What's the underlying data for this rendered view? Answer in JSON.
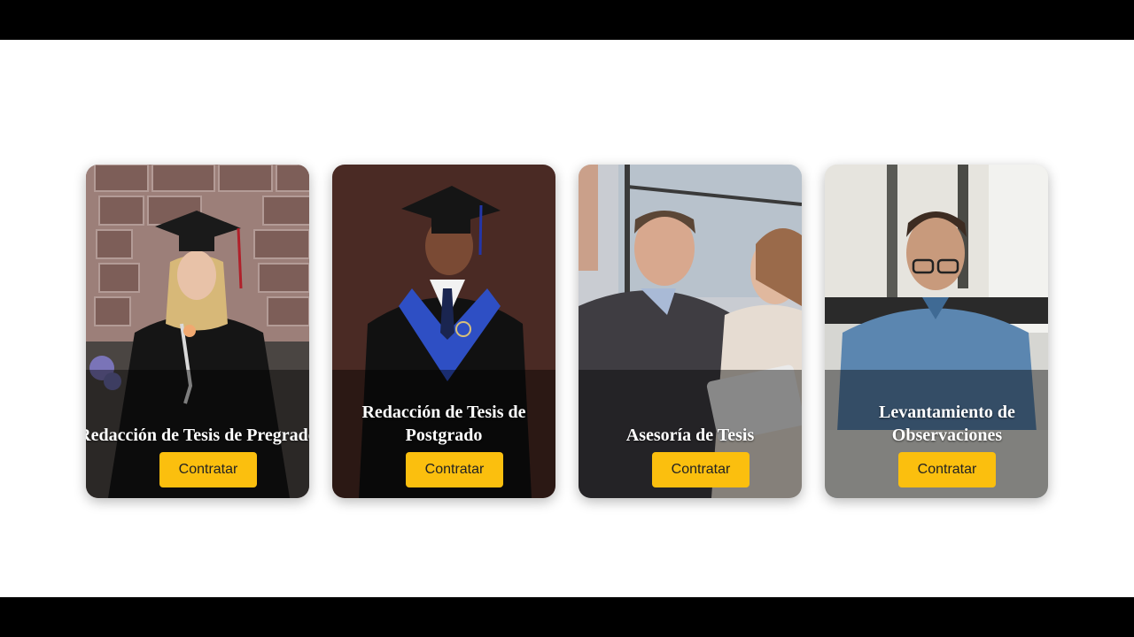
{
  "services": [
    {
      "title": "Redacción de Tesis de Pregrado",
      "button": "Contratar"
    },
    {
      "title": "Redacción de Tesis de Postgrado",
      "button": "Contratar"
    },
    {
      "title": "Asesoría de Tesis",
      "button": "Contratar"
    },
    {
      "title": "Levantamiento de Observaciones",
      "button": "Contratar"
    }
  ],
  "colors": {
    "button": "#fbbf0e",
    "background": "#ffffff"
  },
  "icons": [
    "graduate-photo",
    "graduate-photo",
    "consulting-photo",
    "office-photo"
  ]
}
